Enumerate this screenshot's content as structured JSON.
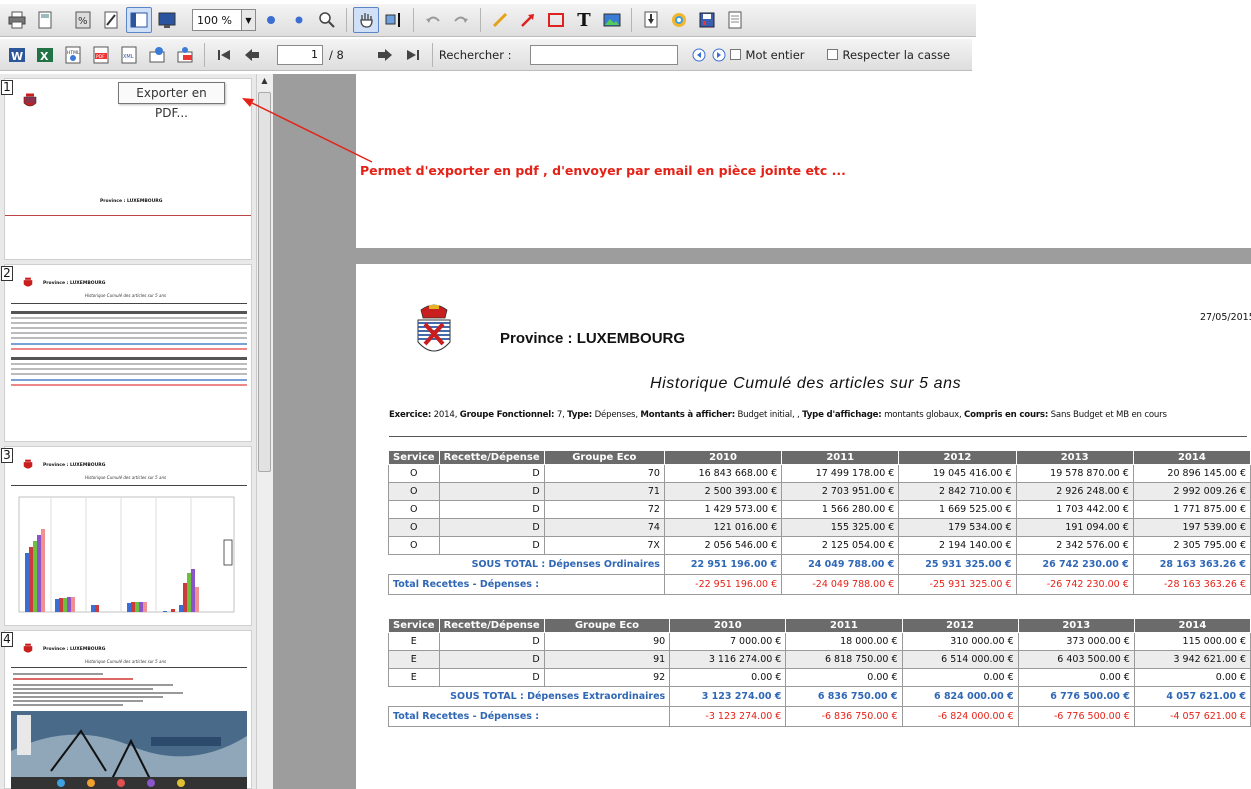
{
  "toolbar": {
    "zoom": "100 %",
    "page_current": "1",
    "page_total": "/ 8",
    "search_label": "Rechercher :",
    "whole_word": "Mot entier",
    "match_case": "Respecter la casse",
    "search_value": ""
  },
  "tooltip": "Exporter en PDF...",
  "annotation": "Permet d'exporter en pdf , d'envoyer par email en pièce jointe etc ...",
  "thumbnails": [
    {
      "num": "1",
      "title": "Province : LUXEMBOURG"
    },
    {
      "num": "2",
      "title": "Province : LUXEMBOURG",
      "subtitle": "Historique Cumulé des articles sur 5 ans"
    },
    {
      "num": "3",
      "title": "Province : LUXEMBOURG",
      "subtitle": "Historique Cumulé des articles sur 5 ans"
    },
    {
      "num": "4",
      "title": "Province : LUXEMBOURG",
      "subtitle": "Historique Cumulé des articles sur 5 ans"
    }
  ],
  "report": {
    "province": "Province : LUXEMBOURG",
    "date": "27/05/2015",
    "title": "Historique Cumulé des articles sur 5 ans",
    "filters": [
      {
        "k": "Exercice:",
        "v": " 2014, "
      },
      {
        "k": "Groupe Fonctionnel:",
        "v": " 7, "
      },
      {
        "k": "Type:",
        "v": " Dépenses, "
      },
      {
        "k": "Montants à afficher:",
        "v": " Budget initial, , "
      },
      {
        "k": "Type d'affichage:",
        "v": " montants globaux, "
      },
      {
        "k": "Compris en cours:",
        "v": " Sans Budget et MB en cours"
      }
    ],
    "headers": [
      "Service",
      "Recette/Dépense",
      "Groupe Eco",
      "2010",
      "2011",
      "2012",
      "2013",
      "2014"
    ],
    "table1": {
      "rows": [
        [
          "O",
          "D",
          "70",
          "16 843 668.00 €",
          "17 499 178.00 €",
          "19 045 416.00 €",
          "19 578 870.00 €",
          "20 896 145.00 €"
        ],
        [
          "O",
          "D",
          "71",
          "2 500 393.00 €",
          "2 703 951.00 €",
          "2 842 710.00 €",
          "2 926 248.00 €",
          "2 992 009.26 €"
        ],
        [
          "O",
          "D",
          "72",
          "1 429 573.00 €",
          "1 566 280.00 €",
          "1 669 525.00 €",
          "1 703 442.00 €",
          "1 771 875.00 €"
        ],
        [
          "O",
          "D",
          "74",
          "121 016.00 €",
          "155 325.00 €",
          "179 534.00 €",
          "191 094.00 €",
          "197 539.00 €"
        ],
        [
          "O",
          "D",
          "7X",
          "2 056 546.00 €",
          "2 125 054.00 €",
          "2 194 140.00 €",
          "2 342 576.00 €",
          "2 305 795.00 €"
        ]
      ],
      "subtotal_label": "SOUS TOTAL : Dépenses Ordinaires",
      "subtotal": [
        "22 951 196.00 €",
        "24 049 788.00 €",
        "25 931 325.00 €",
        "26 742 230.00 €",
        "28 163 363.26 €"
      ],
      "total_label": "Total Recettes - Dépenses :",
      "total": [
        "-22 951 196.00 €",
        "-24 049 788.00 €",
        "-25 931 325.00 €",
        "-26 742 230.00 €",
        "-28 163 363.26 €"
      ]
    },
    "table2": {
      "rows": [
        [
          "E",
          "D",
          "90",
          "7 000.00 €",
          "18 000.00 €",
          "310 000.00 €",
          "373 000.00 €",
          "115 000.00 €"
        ],
        [
          "E",
          "D",
          "91",
          "3 116 274.00 €",
          "6 818 750.00 €",
          "6 514 000.00 €",
          "6 403 500.00 €",
          "3 942 621.00 €"
        ],
        [
          "E",
          "D",
          "92",
          "0.00 €",
          "0.00 €",
          "0.00 €",
          "0.00 €",
          "0.00 €"
        ]
      ],
      "subtotal_label": "SOUS TOTAL : Dépenses Extraordinaires",
      "subtotal": [
        "3 123 274.00 €",
        "6 836 750.00 €",
        "6 824 000.00 €",
        "6 776 500.00 €",
        "4 057 621.00 €"
      ],
      "total_label": "Total Recettes - Dépenses :",
      "total": [
        "-3 123 274.00 €",
        "-6 836 750.00 €",
        "-6 824 000.00 €",
        "-6 776 500.00 €",
        "-4 057 621.00 €"
      ]
    }
  },
  "colors": {
    "accent_red": "#e52217",
    "link_blue": "#2f67b5",
    "header_gray": "#6b6b6b"
  }
}
